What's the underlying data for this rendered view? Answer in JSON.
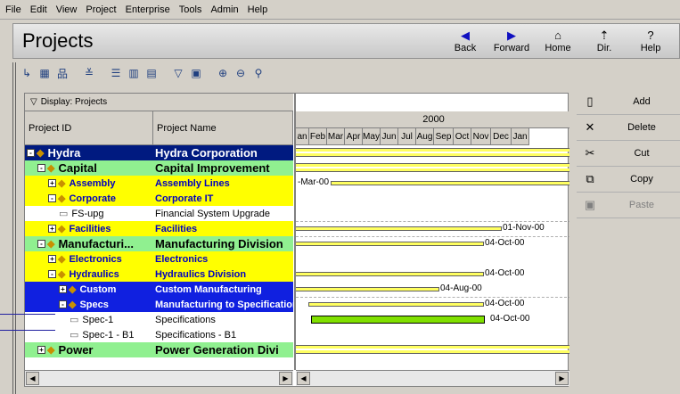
{
  "menu": [
    "File",
    "Edit",
    "View",
    "Project",
    "Enterprise",
    "Tools",
    "Admin",
    "Help"
  ],
  "header": {
    "title": "Projects",
    "buttons": [
      {
        "label": "Back",
        "icon": "◀"
      },
      {
        "label": "Forward",
        "icon": "▶"
      },
      {
        "label": "Home",
        "icon": "⌂"
      },
      {
        "label": "Dir.",
        "icon": "⇡"
      },
      {
        "label": "Help",
        "icon": "?"
      }
    ]
  },
  "display_label": "Display: Projects",
  "columns": {
    "id": "Project ID",
    "name": "Project Name"
  },
  "gantt": {
    "year": "2000",
    "months": [
      "an",
      "Feb",
      "Mar",
      "Apr",
      "May",
      "Jun",
      "Jul",
      "Aug",
      "Sep",
      "Oct",
      "Nov",
      "Dec",
      "Jan"
    ]
  },
  "rows": [
    {
      "id": "Hydra",
      "name": "Hydra Corporation",
      "expander": "-",
      "icon": "diamond",
      "bg": "#001a80",
      "fg": "#ffffff",
      "large": true,
      "indent": 0
    },
    {
      "id": "Capital",
      "name": "Capital Improvement",
      "expander": "-",
      "icon": "diamond",
      "bg": "#90f090",
      "fg": "#000000",
      "large": true,
      "indent": 1
    },
    {
      "id": "Assembly",
      "name": "Assembly Lines",
      "expander": "+",
      "icon": "diamond",
      "bg": "#ffff00",
      "fg": "#0000c0",
      "large": false,
      "indent": 2
    },
    {
      "id": "Corporate",
      "name": "Corporate IT",
      "expander": "-",
      "icon": "diamond",
      "bg": "#ffff00",
      "fg": "#0000c0",
      "large": false,
      "indent": 2
    },
    {
      "id": "FS-upg",
      "name": "Financial System Upgrade",
      "expander": "",
      "icon": "folder",
      "bg": "#ffffff",
      "fg": "#000000",
      "large": false,
      "indent": 3
    },
    {
      "id": "Facilities",
      "name": "Facilities",
      "expander": "+",
      "icon": "diamond",
      "bg": "#ffff00",
      "fg": "#0000c0",
      "large": false,
      "indent": 2
    },
    {
      "id": "Manufacturi...",
      "name": "Manufacturing Division",
      "expander": "-",
      "icon": "diamond",
      "bg": "#90f090",
      "fg": "#000000",
      "large": true,
      "indent": 1
    },
    {
      "id": "Electronics",
      "name": "Electronics",
      "expander": "+",
      "icon": "diamond",
      "bg": "#ffff00",
      "fg": "#0000c0",
      "large": false,
      "indent": 2
    },
    {
      "id": "Hydraulics",
      "name": "Hydraulics Division",
      "expander": "-",
      "icon": "diamond",
      "bg": "#ffff00",
      "fg": "#0000c0",
      "large": false,
      "indent": 2
    },
    {
      "id": "Custom",
      "name": "Custom Manufacturing",
      "expander": "+",
      "icon": "diamond",
      "bg": "#1020e0",
      "fg": "#ffffff",
      "large": false,
      "indent": 3
    },
    {
      "id": "Specs",
      "name": "Manufacturing to Specifications",
      "expander": "-",
      "icon": "diamond",
      "bg": "#1020e0",
      "fg": "#ffffff",
      "large": false,
      "indent": 3
    },
    {
      "id": "Spec-1",
      "name": "Specifications",
      "expander": "",
      "icon": "folder-open",
      "bg": "#ffffff",
      "fg": "#000000",
      "large": false,
      "indent": 4
    },
    {
      "id": "Spec-1 - B1",
      "name": "Specifications - B1",
      "expander": "",
      "icon": "folder",
      "bg": "#ffffff",
      "fg": "#000000",
      "large": false,
      "indent": 4
    },
    {
      "id": "Power",
      "name": "Power Generation Divi",
      "expander": "+",
      "icon": "diamond",
      "bg": "#90f090",
      "fg": "#000000",
      "large": true,
      "indent": 1
    }
  ],
  "gantt_labels": [
    {
      "row": 2,
      "text": "-Mar-00"
    },
    {
      "row": 5,
      "text": "01-Nov-00"
    },
    {
      "row": 6,
      "text": "04-Oct-00"
    },
    {
      "row": 8,
      "text": "04-Oct-00"
    },
    {
      "row": 9,
      "text": "04-Aug-00"
    },
    {
      "row": 10,
      "text": "04-Oct-00"
    },
    {
      "row": 11,
      "text": "04-Oct-00"
    }
  ],
  "side_buttons": [
    {
      "label": "Add",
      "icon": "▯",
      "enabled": true
    },
    {
      "label": "Delete",
      "icon": "✕",
      "enabled": true
    },
    {
      "label": "Cut",
      "icon": "✂",
      "enabled": true
    },
    {
      "label": "Copy",
      "icon": "⧉",
      "enabled": true
    },
    {
      "label": "Paste",
      "icon": "▣",
      "enabled": false
    }
  ],
  "colors": {
    "bar_yellow": "#ffff60",
    "bar_green": "#80e000",
    "selection": "#1020e0",
    "root": "#001a80"
  }
}
